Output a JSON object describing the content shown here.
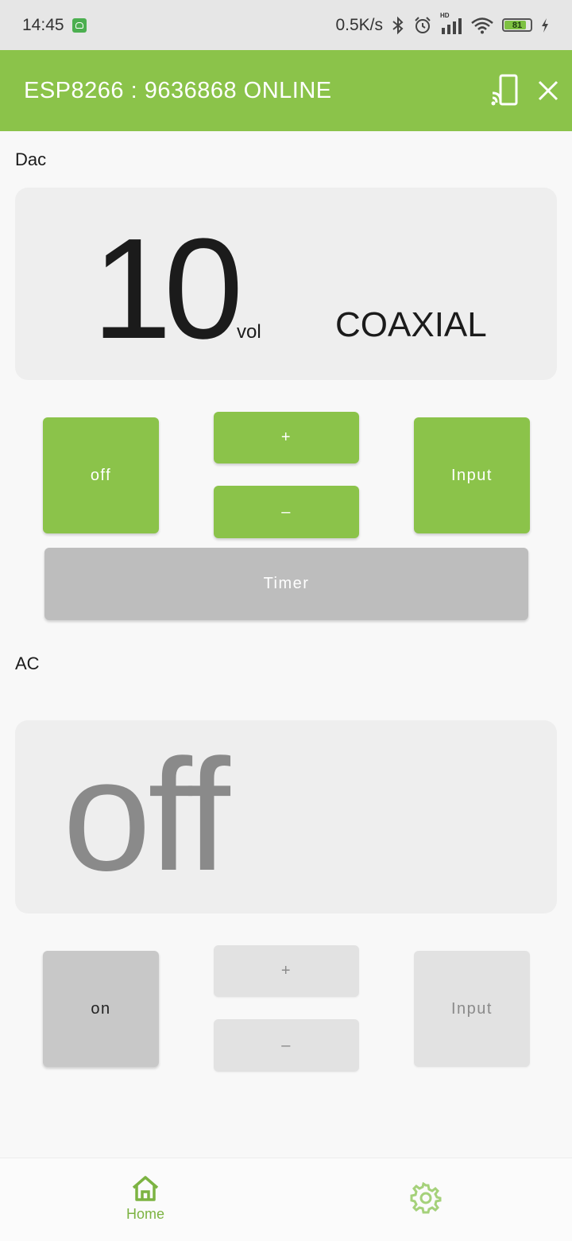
{
  "status_bar": {
    "time": "14:45",
    "net_speed": "0.5K/s",
    "network": "HD",
    "battery": "81"
  },
  "appbar": {
    "title": "ESP8266 : 9636868 ONLINE",
    "cast_icon": "cast-icon",
    "close_icon": "close-icon"
  },
  "dac": {
    "label": "Dac",
    "volume": "10",
    "unit": "vol",
    "source": "COAXIAL",
    "buttons": {
      "power": "off",
      "plus": "+",
      "minus": "–",
      "input": "Input",
      "timer": "Timer"
    }
  },
  "ac": {
    "label": "AC",
    "state": "off",
    "buttons": {
      "power": "on",
      "plus": "+",
      "minus": "–",
      "input": "Input"
    }
  },
  "bottom_nav": {
    "home": "Home",
    "home_icon": "home-icon",
    "settings_icon": "gear-icon"
  },
  "colors": {
    "accent": "#8bc34a",
    "disabled": "#bdbdbd"
  }
}
